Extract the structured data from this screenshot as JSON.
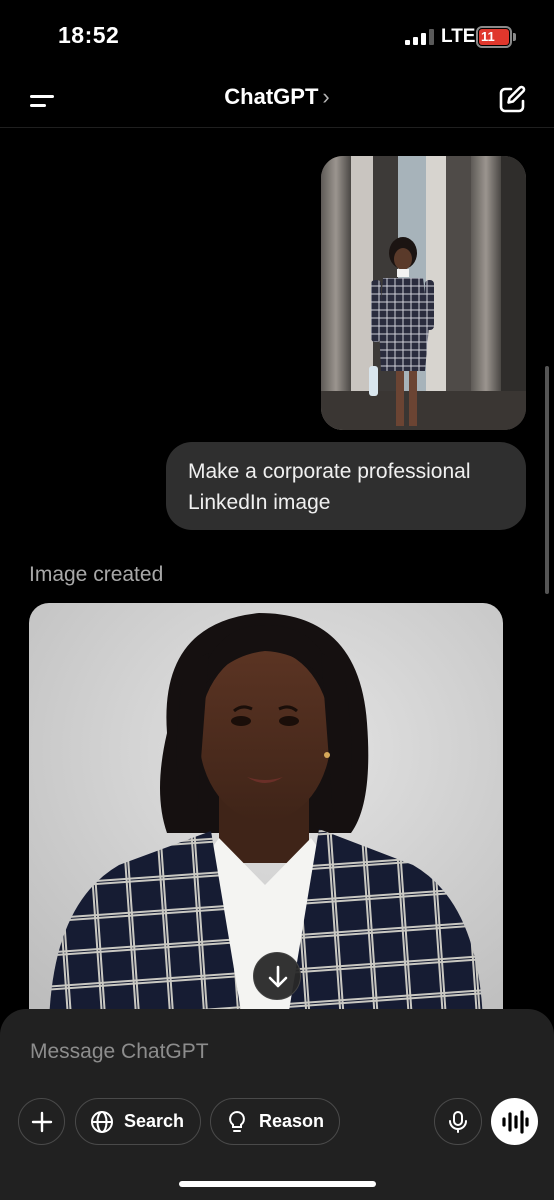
{
  "status_bar": {
    "time": "18:52",
    "network": "LTE",
    "battery_level": "11",
    "battery_color": "#e0372c"
  },
  "header": {
    "title": "ChatGPT",
    "title_chevron": "›",
    "menu_icon": "menu-icon",
    "new_chat_icon": "edit-icon"
  },
  "conversation": {
    "user_message": {
      "attachment": "uploaded-photo",
      "text": "Make a corporate professional LinkedIn image"
    },
    "assistant_status": "Image created",
    "generated_image": "generated-portrait"
  },
  "composer": {
    "placeholder": "Message ChatGPT",
    "buttons": {
      "add_icon": "plus-icon",
      "search_label": "Search",
      "search_icon": "globe-icon",
      "reason_label": "Reason",
      "reason_icon": "lightbulb-icon",
      "mic_icon": "microphone-icon",
      "voice_icon": "voice-waveform-icon"
    }
  },
  "colors": {
    "background": "#000000",
    "bubble": "#2f2f2f",
    "composer": "#212121",
    "muted_text": "#a8a8a8"
  }
}
